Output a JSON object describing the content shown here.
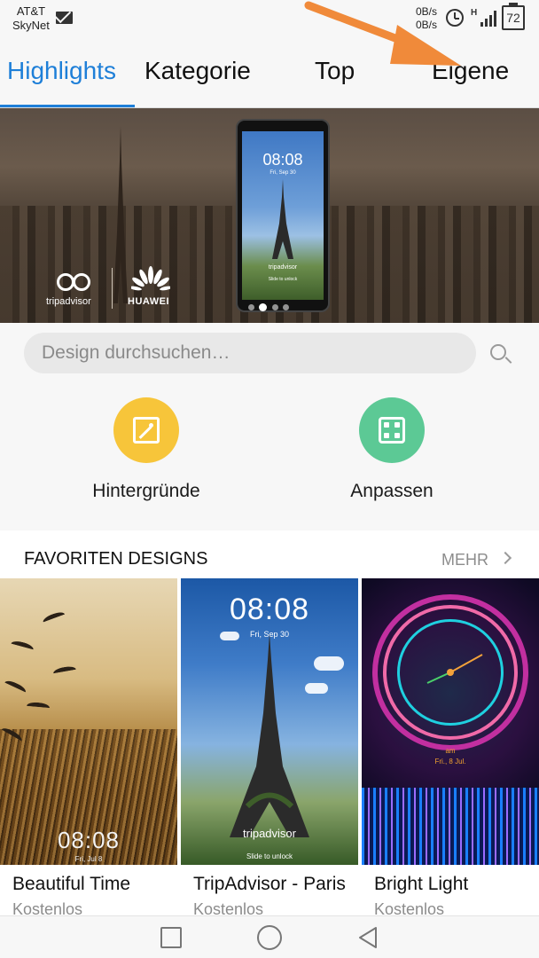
{
  "status_bar": {
    "carrier_line1": "AT&T",
    "carrier_line2": "SkyNet",
    "net_up": "0B/s",
    "net_down": "0B/s",
    "network_type": "H",
    "battery": "72"
  },
  "tabs": [
    {
      "label": "Highlights",
      "active": true
    },
    {
      "label": "Kategorie",
      "active": false
    },
    {
      "label": "Top",
      "active": false
    },
    {
      "label": "Eigene",
      "active": false
    }
  ],
  "banner": {
    "partner_left": "tripadvisor",
    "partner_right": "HUAWEI",
    "phone_time": "08:08",
    "phone_date": "Fri, Sep 30",
    "phone_brand": "tripadvisor",
    "phone_unlock": "Slide to unlock",
    "active_slide": 1,
    "slide_count": 4
  },
  "search": {
    "placeholder": "Design durchsuchen…"
  },
  "quick_actions": [
    {
      "label": "Hintergründe",
      "icon": "wallpaper-icon",
      "color": "#f7c53a"
    },
    {
      "label": "Anpassen",
      "icon": "customize-icon",
      "color": "#5cc995"
    }
  ],
  "favorites": {
    "title": "FAVORITEN DESIGNS",
    "more_label": "MEHR",
    "items": [
      {
        "name": "Beautiful Time",
        "price": "Kostenlos",
        "clock": "08:08",
        "date": "Fri, Jul 8"
      },
      {
        "name": "TripAdvisor - Paris",
        "price": "Kostenlos",
        "clock": "08:08",
        "date": "Fri, Sep 30",
        "brand": "tripadvisor",
        "unlock": "Slide to unlock"
      },
      {
        "name": "Bright Light",
        "price": "Kostenlos",
        "am": "am",
        "date": "Fri., 8 Jul."
      }
    ]
  },
  "colors": {
    "accent": "#1e7fd8",
    "annotation_arrow": "#f08a3a"
  },
  "nav_bar": {
    "icons": [
      "recent-apps-icon",
      "home-icon",
      "back-icon"
    ]
  }
}
